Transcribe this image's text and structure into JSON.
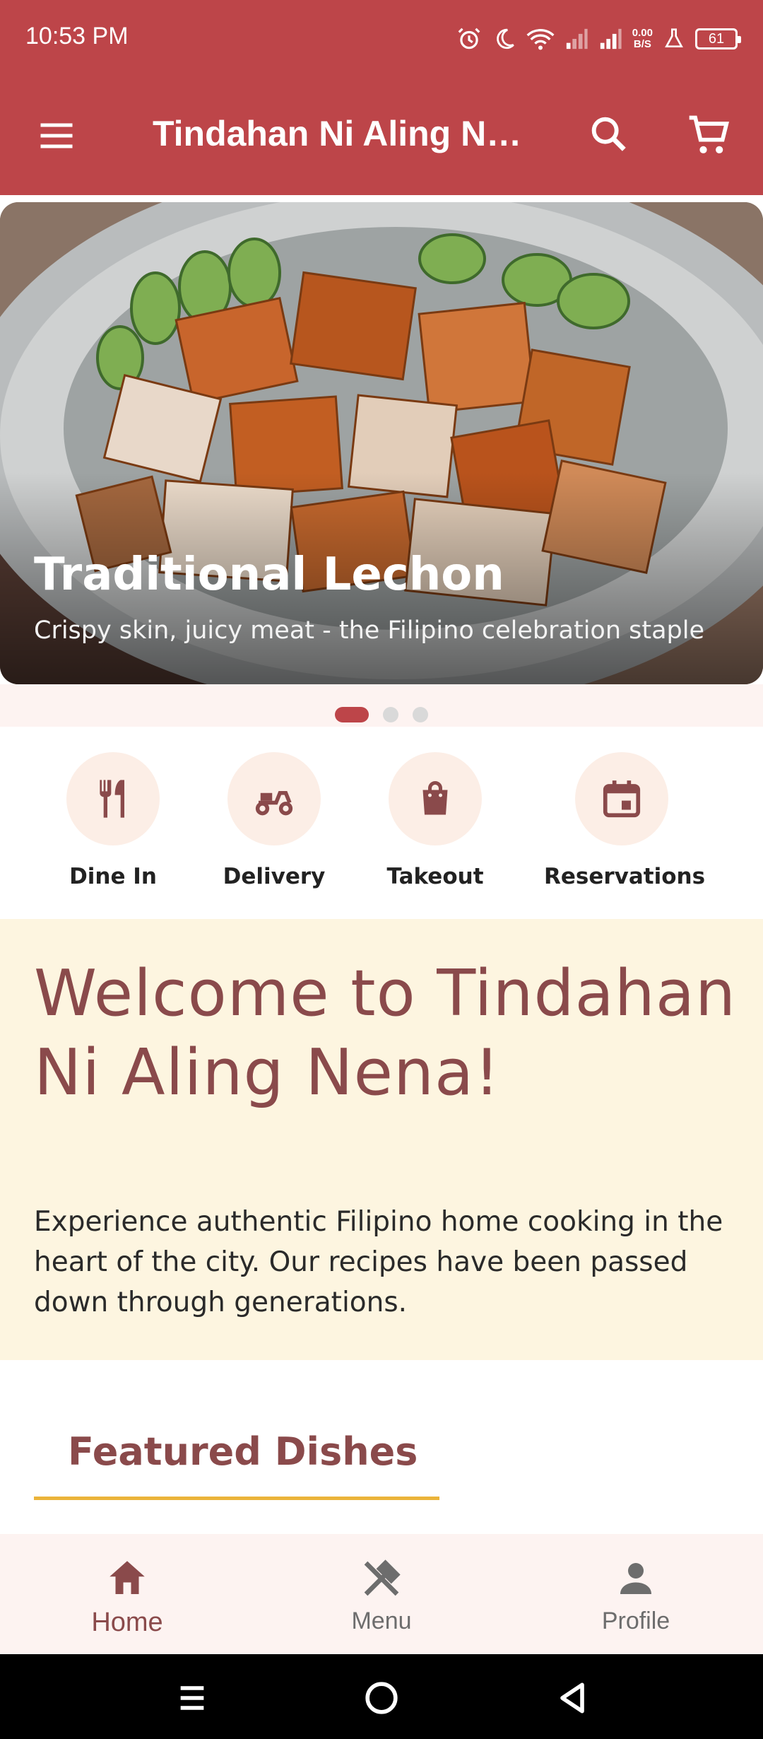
{
  "status_bar": {
    "time": "10:53 PM",
    "net_speed_value": "0.00",
    "net_speed_unit": "B/S",
    "battery": "61"
  },
  "app_bar": {
    "title": "Tindahan Ni Aling Ne...",
    "icons": [
      "menu-icon",
      "search-icon",
      "cart-icon"
    ]
  },
  "hero": {
    "title": "Traditional Lechon",
    "subtitle": "Crispy skin, juicy meat - the Filipino celebration staple",
    "slide_count": 3,
    "active_slide": 1
  },
  "services": [
    {
      "label": "Dine In",
      "icon": "utensils-icon"
    },
    {
      "label": "Delivery",
      "icon": "scooter-icon"
    },
    {
      "label": "Takeout",
      "icon": "bag-icon"
    },
    {
      "label": "Reservations",
      "icon": "calendar-icon"
    }
  ],
  "welcome": {
    "heading": "Welcome to Tindahan Ni Aling Nena!",
    "body": "Experience authentic Filipino home cooking in the heart of the city. Our recipes have been passed down through generations."
  },
  "featured": {
    "title": "Featured Dishes"
  },
  "bottom_nav": [
    {
      "label": "Home",
      "icon": "home-icon",
      "active": true
    },
    {
      "label": "Menu",
      "icon": "fork-knife-icon",
      "active": false
    },
    {
      "label": "Profile",
      "icon": "person-icon",
      "active": false
    }
  ],
  "colors": {
    "primary": "#BD4549",
    "heading": "#8A4A4B",
    "welcome_bg": "#FDF5E0",
    "accent_underline": "#EBB43A",
    "nav_bg": "#FDF3F1"
  }
}
